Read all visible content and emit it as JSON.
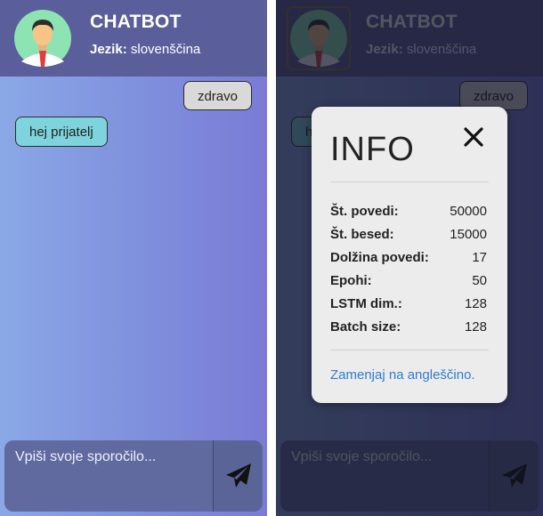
{
  "chatbot": {
    "title": "CHATBOT",
    "language_label": "Jezik:",
    "language_value": "slovenščina",
    "messages": {
      "user": "zdravo",
      "bot": "hej prijatelj"
    },
    "input": {
      "placeholder": "Vpiši svoje sporočilo...",
      "value": ""
    },
    "icons": {
      "avatar": "user-avatar-icon",
      "send": "paper-plane-icon"
    }
  },
  "modal": {
    "title": "INFO",
    "close_icon": "close-icon",
    "stats": [
      {
        "label": "Št. povedi:",
        "value": "50000"
      },
      {
        "label": "Št. besed:",
        "value": "15000"
      },
      {
        "label": "Dolžina povedi:",
        "value": "17"
      },
      {
        "label": "Epohi:",
        "value": "50"
      },
      {
        "label": "LSTM dim.:",
        "value": "128"
      },
      {
        "label": "Batch size:",
        "value": "128"
      }
    ],
    "switch_link": "Zamenjaj na angleščino."
  },
  "colors": {
    "header_bg": "#5a5f9c",
    "bot_bubble": "#7fd3dc",
    "user_bubble": "#d9d9d9",
    "link": "#2f7bd6"
  }
}
